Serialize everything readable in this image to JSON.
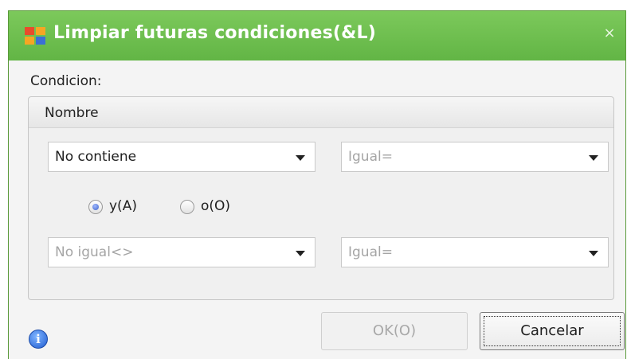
{
  "window": {
    "title": "Limpiar futuras condiciones(&L)",
    "close_glyph": "×",
    "accent_color": "#62b545"
  },
  "condition_label": "Condicion:",
  "group": {
    "title": "Nombre",
    "row1": {
      "operator": "No contiene",
      "value": "Igual="
    },
    "logic": {
      "and_label": "y(A)",
      "or_label": "o(O)",
      "selected": "and"
    },
    "row2": {
      "operator": "No igual<>",
      "value": "Igual="
    }
  },
  "buttons": {
    "ok_label": "OK(O)",
    "cancel_label": "Cancelar"
  },
  "icons": {
    "app": "app-grid-icon",
    "info": "info-icon",
    "info_glyph": "i"
  }
}
